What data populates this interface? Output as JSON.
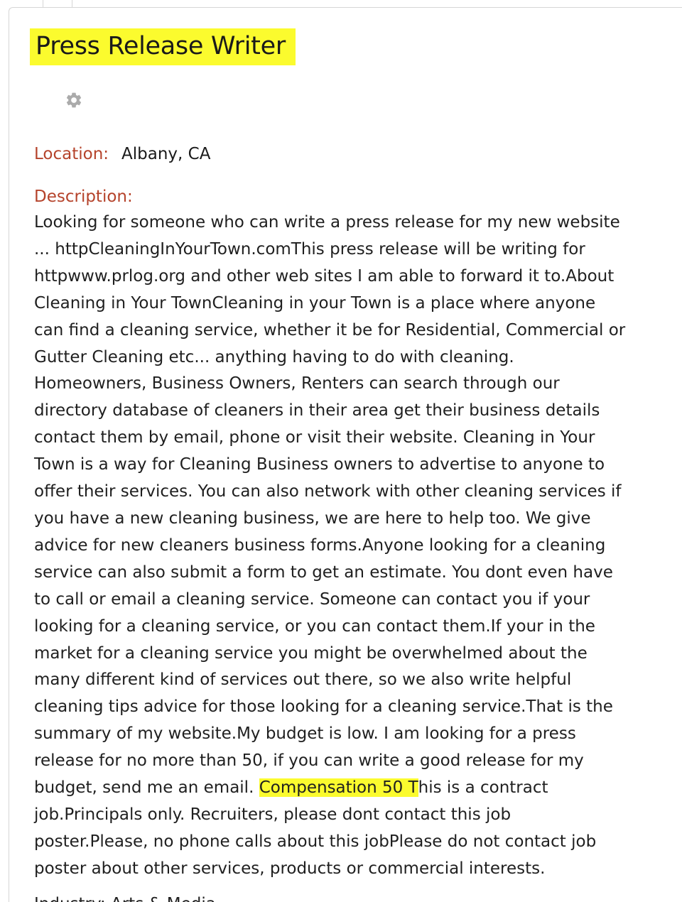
{
  "listing": {
    "title": "Press Release Writer",
    "gear_icon": "gear-icon",
    "location_label": "Location:",
    "location_value": "Albany, CA",
    "description_label": "Description:",
    "description_lines": [
      "Looking for someone who can write a press release for my new website",
      "... httpCleaningInYourTown.comThis press release will be writing for",
      "httpwww.prlog.org and other web sites I am able to forward it to.About",
      "Cleaning in Your TownCleaning in your Town is a place where anyone",
      "can find a cleaning service, whether it be for Residential, Commercial or",
      "Gutter Cleaning etc... anything having to do with cleaning.",
      "Homeowners, Business Owners, Renters can search through our",
      "directory database of cleaners in their area get their business details",
      "contact them by email, phone or visit their website. Cleaning in Your",
      "Town is a way for Cleaning Business owners to advertise to anyone to",
      "offer their services. You can also network with other cleaning services if",
      "you have a new cleaning business, we are here to help too. We give",
      "advice for new cleaners business forms.Anyone looking for a cleaning",
      "service can also submit a form to get an estimate. You dont even have",
      "to call or email a cleaning service. Someone can contact you if your",
      "looking for a cleaning service, or you can contact them.If your in the",
      "market for a cleaning service you might be overwhelmed about the",
      "many different kind of services out there, so we also write helpful",
      "cleaning tips advice for those looking for a cleaning service.That is the",
      "summary of my website.My budget is low. I am looking for a press",
      "release for no more than 50, if you can write a good release for my"
    ],
    "line22_before": "budget, send me an email. ",
    "line22_highlight": "Compensation 50 T",
    "line22_after": "his is a contract",
    "description_tail_lines": [
      "job.Principals only. Recruiters, please dont contact this job",
      "poster.Please, no phone calls about this jobPlease do not contact job",
      "poster about other services, products or commercial interests."
    ],
    "cut_off_text": "Industry: Arts & Media",
    "highlight_color": "#fbfb2e",
    "label_color": "#b5432b"
  }
}
